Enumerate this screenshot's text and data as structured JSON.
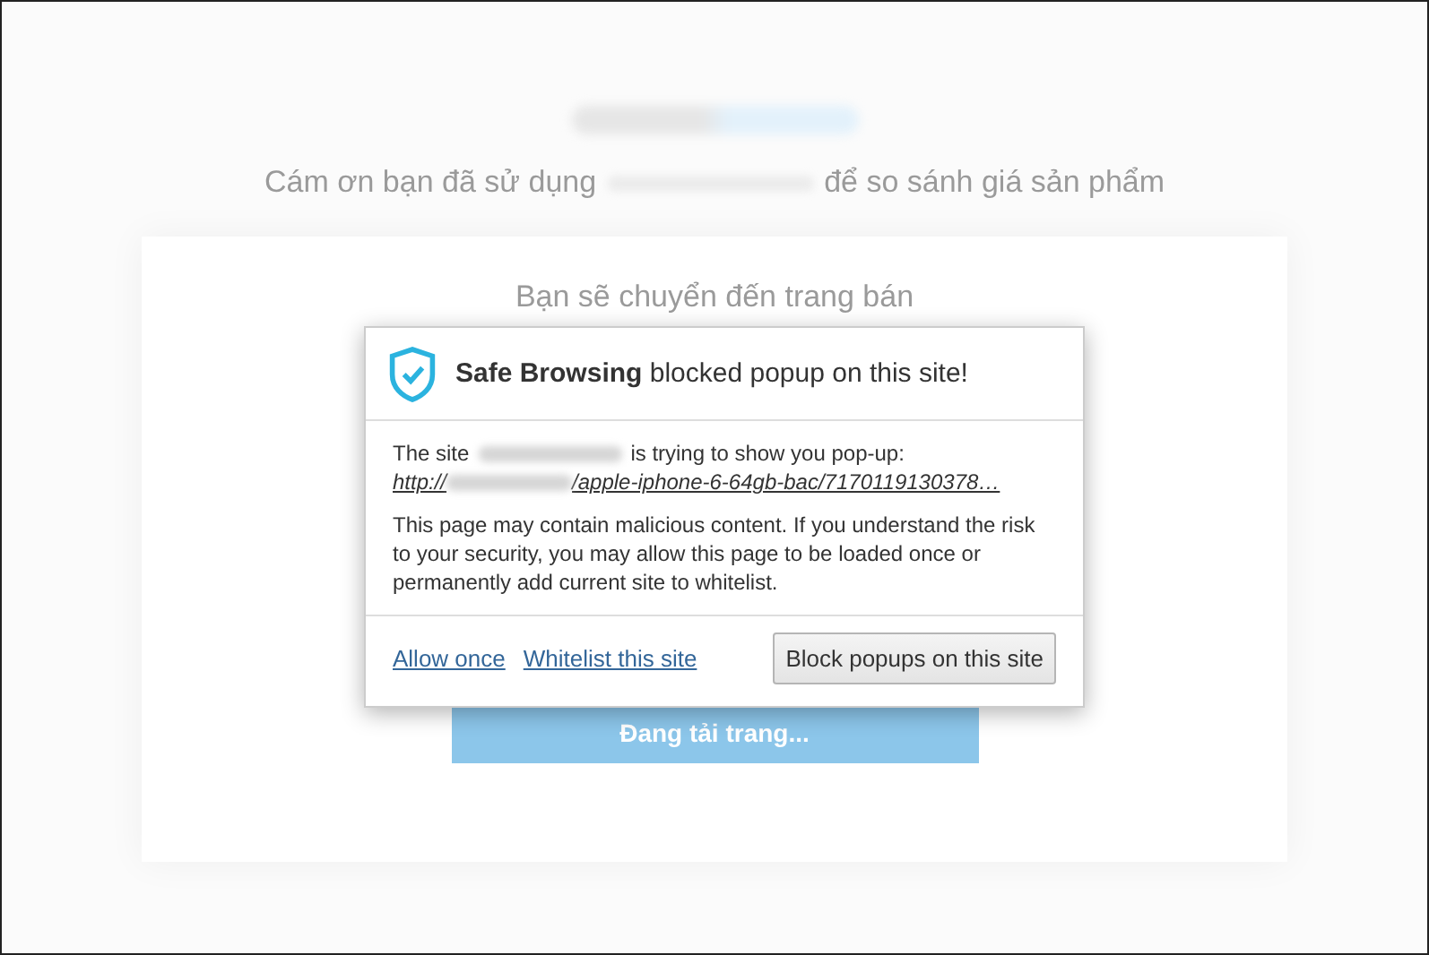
{
  "page": {
    "tagline_before": "Cám ơn bạn đã sử dụng",
    "tagline_after": "để so sánh giá sản phẩm",
    "redirect_text": "Bạn sẽ chuyển đến trang bán",
    "loading_button": "Đang tải trang..."
  },
  "dialog": {
    "title": "**Safe Browsing** blocked popup on this site!",
    "site_before": "The site",
    "site_after": "is trying to show you pop-up:",
    "url_scheme": "http://",
    "url_path": "/apple-iphone-6-64gb-bac/7170119130378…",
    "message": "This page may contain malicious content. If you understand the risk to your security, you may allow this page to be loaded once or permanently add current site to whitelist.",
    "links": [
      "Allow once",
      "Whitelist this site"
    ],
    "button": "Block popups on this site"
  }
}
